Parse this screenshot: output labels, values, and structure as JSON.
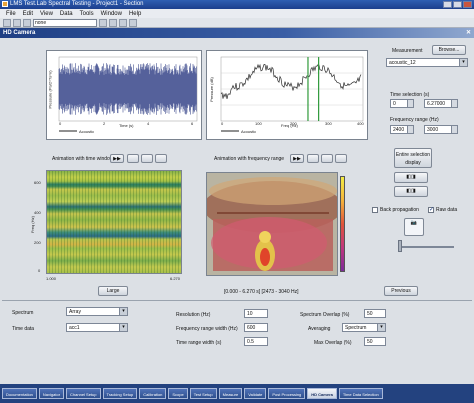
{
  "window": {
    "title": "LMS Test.Lab Spectral Testing - Project1 - Section"
  },
  "menu": [
    "File",
    "Edit",
    "View",
    "Data",
    "Tools",
    "Window",
    "Help"
  ],
  "toolbar": {
    "combo_value": "none"
  },
  "panel_title": "HD Camera",
  "time_plot": {
    "ylabel": "Pressure (Pa/2^?s^n)",
    "xlabel": "Time (s)",
    "legend": "Acoustic",
    "xticks": [
      "0",
      "2",
      "4",
      "6"
    ],
    "y_max": 1.0,
    "y_min": -1.0
  },
  "freq_plot": {
    "ylabel": "Pressure (dB)",
    "xlabel": "Freq (Hz)",
    "xticks": [
      "0",
      "100",
      "200",
      "300",
      "400"
    ],
    "legend": "Acoustic",
    "cursor_freq": [
      245,
      275
    ]
  },
  "animation": {
    "time_label": "Animation with time window",
    "freq_label": "Animation with frequency range",
    "large_button": "Large",
    "previous_button": "Previous",
    "time_range": "[0.000 - 6.270 s] [2473 - 3040 Hz]",
    "heat_yticks": [
      "600",
      "400",
      "200",
      "0"
    ],
    "heat_xlabel": "1.000",
    "heat_xend": "6.270",
    "heat_ylabel": "Freq (Hz)"
  },
  "right_panel": {
    "measurement_label": "Measurement",
    "browse_button": "Browse...",
    "measurement_value": "acoustic_12",
    "time_selection_label": "Time selection (s)",
    "time_from": "0",
    "time_to": "6.27000",
    "freq_range_label": "Frequency range (Hz)",
    "freq_from": "2400",
    "freq_to": "3000",
    "entire_selection_button": "Entire selection\ndisplay",
    "back_propagation_label": "Back propagation",
    "raw_data_label": "Raw data"
  },
  "settings": {
    "spectrum_label": "Spectrum",
    "spectrum_value": "Array",
    "time_data_label": "Time data",
    "time_data_value": "acc1",
    "resolution_label": "Resolution (Hz)",
    "resolution_value": "10",
    "freq_width_label": "Frequency range width (Hz)",
    "freq_width_value": "600",
    "time_width_label": "Time range width (s)",
    "time_width_value": "0.5",
    "spectrum_overlap_label": "Spectrum Overlap (%)",
    "spectrum_overlap_value": "50",
    "averaging_label": "Averaging",
    "averaging_value": "Spectrum",
    "max_overlap_label": "Max Overlap (%)",
    "max_overlap_value": "50"
  },
  "tabs": [
    "Documentation",
    "Navigator",
    "Channel Setup",
    "Tracking Setup",
    "Calibration",
    "Scope",
    "Test Setup",
    "Measure",
    "Validate",
    "Post Processing",
    "HD Camera",
    "Time Data Selection"
  ],
  "active_tab": "HD Camera"
}
